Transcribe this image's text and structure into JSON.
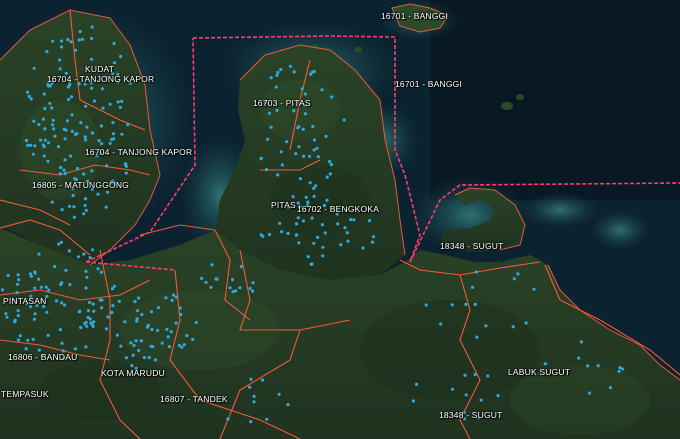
{
  "map": {
    "colors": {
      "sea": "#0b2330",
      "land": "#243a22",
      "boundary_state": "#ff3b6b",
      "boundary_district": "#ff5a3c",
      "point": "#2fa8df",
      "label": "#ffffff"
    },
    "labels": {
      "banggi_top": "16701 - BANGGI",
      "banggi_mid": "16701 - BANGGI",
      "kudat": "KUDAT",
      "tanjong_kapor_top": "16704 - TANJONG KAPOR",
      "tanjong_kapor_mid": "16704 - TANJONG KAPOR",
      "matunggong": "16805 - MATUNGGONG",
      "pitas_code": "16703 - PITAS",
      "pitas": "PITAS",
      "bengkoka": "16702 - BENGKOKA",
      "sugut_north": "18348 - SUGUT",
      "pintasan": "PINTASAN",
      "bandau": "16806 - BANDAU",
      "kota_marudu": "KOTA MARUDU",
      "tempasuk": "TEMPASUK",
      "tandek": "16807 - TANDEK",
      "labuk_sugut": "LABUK SUGUT",
      "sugut_south": "18348 - SUGUT"
    }
  }
}
